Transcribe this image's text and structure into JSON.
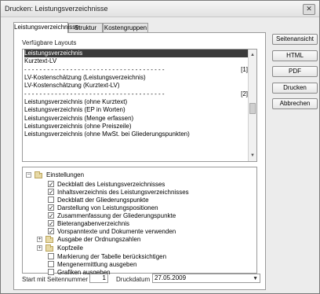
{
  "window": {
    "title": "Drucken: Leistungsverzeichnisse"
  },
  "tabs": [
    "Leistungsverzeichnisse",
    "Struktur",
    "Kostengruppen"
  ],
  "layouts": {
    "label": "Verfügbare Layouts",
    "items": [
      {
        "text": "Leistungsverzeichnis",
        "selected": true
      },
      {
        "text": "Kurztext-LV"
      },
      {
        "text": "- - - - - - - - - - - - - - - - - - - - - - - - - - - - - - - - - - - - -",
        "suffix": "[1]"
      },
      {
        "text": "LV-Kostenschätzung (Leistungsverzeichnis)"
      },
      {
        "text": "LV-Kostenschätzung (Kurztext-LV)"
      },
      {
        "text": "- - - - - - - - - - - - - - - - - - - - - - - - - - - - - - - - - - - - -",
        "suffix": "[2]"
      },
      {
        "text": "Leistungsverzeichnis (ohne Kurztext)"
      },
      {
        "text": "Leistungsverzeichnis (EP in Worten)"
      },
      {
        "text": "Leistungsverzeichnis (Menge erfassen)"
      },
      {
        "text": "Leistungsverzeichnis (ohne Preiszeile)"
      },
      {
        "text": "Leistungsverzeichnis (ohne MwSt. bei Gliederungspunkten)"
      }
    ]
  },
  "settings": {
    "root_label": "Einstellungen",
    "items": [
      {
        "text": "Deckblatt des Leistungsverzeichnisses",
        "type": "checkbox",
        "checked": true
      },
      {
        "text": "Inhaltsverzeichnis des Leistungsverzeichnisses",
        "type": "checkbox",
        "checked": true
      },
      {
        "text": "Deckblatt der Gliederungspunkte",
        "type": "checkbox",
        "checked": false
      },
      {
        "text": "Darstellung von Leistungspositionen",
        "type": "checkbox",
        "checked": true
      },
      {
        "text": "Zusammenfassung der Gliederungspunkte",
        "type": "checkbox",
        "checked": true
      },
      {
        "text": "Bieterangabenverzeichnis",
        "type": "checkbox",
        "checked": true
      },
      {
        "text": "Vorspanntexte und Dokumente verwenden",
        "type": "checkbox",
        "checked": true
      },
      {
        "text": "Ausgabe der Ordnungszahlen",
        "type": "folder",
        "expand": "+"
      },
      {
        "text": "Kopfzeile",
        "type": "folder",
        "expand": "+"
      },
      {
        "text": "Markierung der Tabelle berücksichtigen",
        "type": "checkbox",
        "checked": false
      },
      {
        "text": "Mengenermittlung ausgeben",
        "type": "checkbox",
        "checked": false
      },
      {
        "text": "Grafiken ausgeben",
        "type": "checkbox",
        "checked": false
      }
    ]
  },
  "start_page": {
    "label": "Start mit Seitennummer",
    "value": "1"
  },
  "print_date": {
    "label": "Druckdatum",
    "value": "27.05.2009"
  },
  "buttons": {
    "preview": "Seitenansicht",
    "html": "HTML",
    "pdf": "PDF",
    "print": "Drucken",
    "cancel": "Abbrechen"
  },
  "icons": {
    "close": "close-icon",
    "check": "✓",
    "expand": "⊟"
  }
}
